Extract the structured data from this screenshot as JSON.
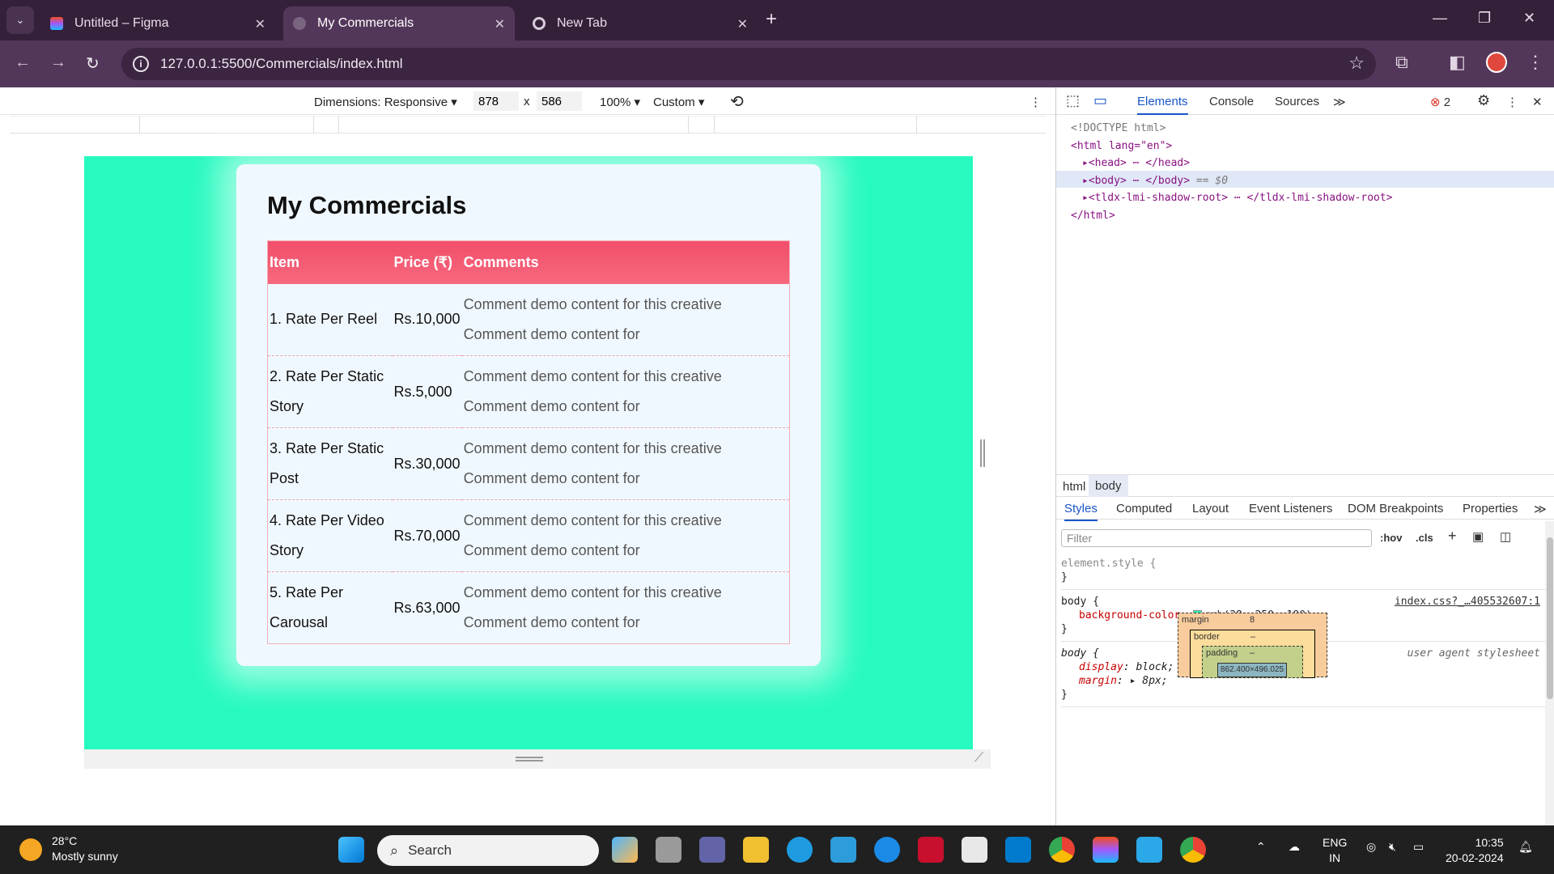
{
  "browser": {
    "tabs": [
      {
        "title": "Untitled – Figma",
        "active": false
      },
      {
        "title": "My Commercials",
        "active": true
      },
      {
        "title": "New Tab",
        "active": false
      }
    ],
    "url": "127.0.0.1:5500/Commercials/index.html"
  },
  "device_toolbar": {
    "dimensions_label": "Dimensions: Responsive",
    "width": "878",
    "x_sep": "x",
    "height": "586",
    "zoom": "100%",
    "throttle": "Custom"
  },
  "page": {
    "title": "My Commercials",
    "headers": [
      "Item",
      "Price (₹)",
      "Comments"
    ],
    "rows": [
      {
        "item": "1. Rate Per Reel",
        "price": "Rs.10,000",
        "c1": "Comment demo content for this creative",
        "c2": "Comment demo content for"
      },
      {
        "item": "2. Rate Per Static Story",
        "price": "Rs.5,000",
        "c1": "Comment demo content for this creative",
        "c2": "Comment demo content for"
      },
      {
        "item": "3. Rate Per Static Post",
        "price": "Rs.30,000",
        "c1": "Comment demo content for this creative",
        "c2": "Comment demo content for"
      },
      {
        "item": "4. Rate Per Video Story",
        "price": "Rs.70,000",
        "c1": "Comment demo content for this creative",
        "c2": "Comment demo content for"
      },
      {
        "item": "5. Rate Per Carousal",
        "price": "Rs.63,000",
        "c1": "Comment demo content for this creative",
        "c2": "Comment demo content for"
      }
    ],
    "background": "#26fabe"
  },
  "devtools": {
    "tabs": [
      "Elements",
      "Console",
      "Sources"
    ],
    "error_count": "2",
    "dom": {
      "doctype": "<!DOCTYPE html>",
      "html_open": "<html lang=\"en\">",
      "head": "<head> ⋯ </head>",
      "body": "<body> ⋯ </body>",
      "body_suffix": "== $0",
      "shadow": "<tldx-lmi-shadow-root> ⋯ </tldx-lmi-shadow-root>",
      "html_close": "</html>"
    },
    "crumbs": [
      "html",
      "body"
    ],
    "style_tabs": [
      "Styles",
      "Computed",
      "Layout",
      "Event Listeners",
      "DOM Breakpoints",
      "Properties"
    ],
    "filter_placeholder": "Filter",
    "hov": ":hov",
    "cls": ".cls",
    "element_style": "element.style {",
    "close_brace": "}",
    "rule1_selector": "body {",
    "rule1_source": "index.css?_…405532607:1",
    "rule1_prop": "background-color",
    "rule1_value": "rgb(38, 250, 190);",
    "rule2_selector": "body {",
    "rule2_source": "user agent stylesheet",
    "rule2_prop1": "display",
    "rule2_val1": "block;",
    "rule2_prop2": "margin",
    "rule2_val2": "8px;",
    "box": {
      "margin_label": "margin",
      "margin": "8",
      "border_label": "border",
      "border": "–",
      "padding_label": "padding",
      "padding": "–",
      "content": "862.400×496.025",
      "side": "8"
    }
  },
  "taskbar": {
    "temp": "28°C",
    "weather": "Mostly sunny",
    "search": "Search",
    "lang1": "ENG",
    "lang2": "IN",
    "time": "10:35",
    "date": "20-02-2024"
  }
}
